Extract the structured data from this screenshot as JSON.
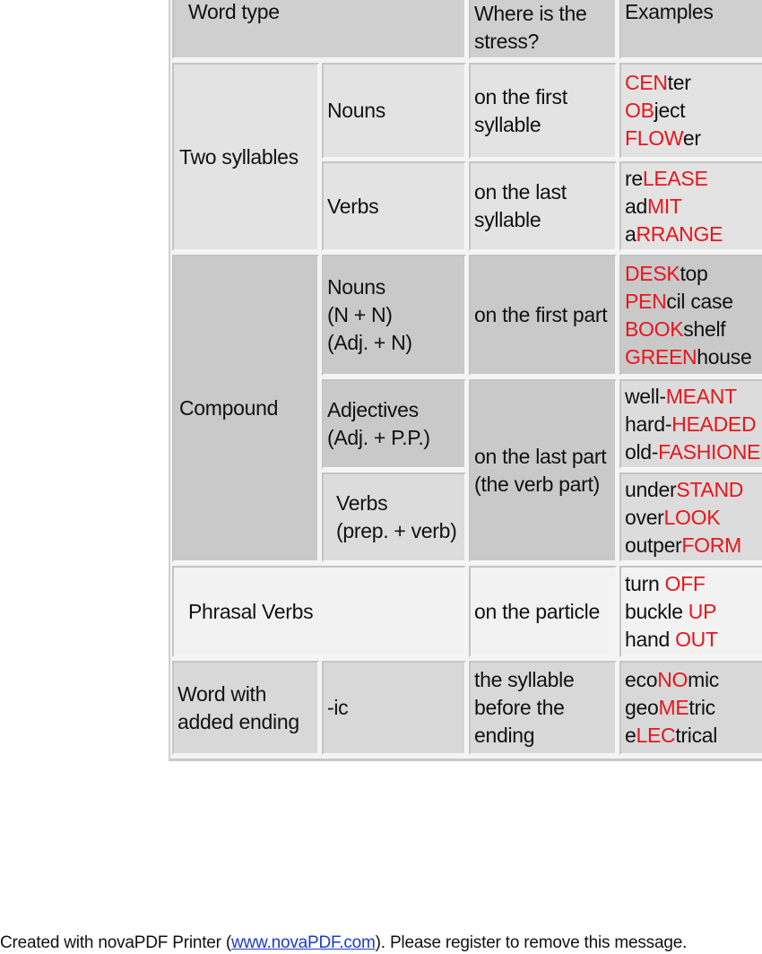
{
  "header": {
    "word_type": "Word type",
    "stress_line1": "Where is the",
    "stress_line2": "stress?",
    "examples": "Examples"
  },
  "rows": {
    "two_syllables": {
      "label": "Two syllables",
      "nouns": {
        "label": "Nouns",
        "stress": [
          "on the first",
          "syllable"
        ],
        "examples": [
          [
            {
              "t": "CEN",
              "r": true
            },
            {
              "t": "ter"
            }
          ],
          [
            {
              "t": "OB",
              "r": true
            },
            {
              "t": "ject"
            }
          ],
          [
            {
              "t": "FLOW",
              "r": true
            },
            {
              "t": "er"
            }
          ]
        ]
      },
      "verbs": {
        "label": "Verbs",
        "stress": [
          "on the last",
          "syllable"
        ],
        "examples": [
          [
            {
              "t": "re"
            },
            {
              "t": "LEASE",
              "r": true
            }
          ],
          [
            {
              "t": "ad"
            },
            {
              "t": "MIT",
              "r": true
            }
          ],
          [
            {
              "t": "a"
            },
            {
              "t": "RRANGE",
              "r": true
            }
          ]
        ]
      }
    },
    "compound": {
      "label": "Compound",
      "nouns": {
        "label": [
          "Nouns",
          "(N + N)",
          "(Adj. + N)"
        ],
        "stress": [
          "on the first part"
        ],
        "examples": [
          [
            {
              "t": "DESK",
              "r": true
            },
            {
              "t": "top"
            }
          ],
          [
            {
              "t": "PEN",
              "r": true
            },
            {
              "t": "cil case"
            }
          ],
          [
            {
              "t": "BOOK",
              "r": true
            },
            {
              "t": "shelf"
            }
          ],
          [
            {
              "t": "GREEN",
              "r": true
            },
            {
              "t": "house"
            }
          ]
        ]
      },
      "adjectives": {
        "label": [
          "Adjectives",
          "(Adj. + P.P.)"
        ],
        "examples": [
          [
            {
              "t": "well-"
            },
            {
              "t": "MEANT",
              "r": true
            }
          ],
          [
            {
              "t": "hard-"
            },
            {
              "t": "HEADED",
              "r": true
            }
          ],
          [
            {
              "t": "old-"
            },
            {
              "t": "FASHIONED",
              "r": true
            }
          ]
        ]
      },
      "verbs": {
        "label": [
          "Verbs",
          "(prep. + verb)"
        ],
        "examples": [
          [
            {
              "t": "under"
            },
            {
              "t": "STAND",
              "r": true
            }
          ],
          [
            {
              "t": "over"
            },
            {
              "t": "LOOK",
              "r": true
            }
          ],
          [
            {
              "t": "outper"
            },
            {
              "t": "FORM",
              "r": true
            }
          ]
        ]
      },
      "last_part_stress": [
        "on the last part",
        "(the verb part)"
      ]
    },
    "phrasal": {
      "label": "Phrasal Verbs",
      "stress": [
        "on the particle"
      ],
      "examples": [
        [
          {
            "t": "turn "
          },
          {
            "t": "OFF",
            "r": true
          }
        ],
        [
          {
            "t": "buckle "
          },
          {
            "t": "UP",
            "r": true
          }
        ],
        [
          {
            "t": "hand "
          },
          {
            "t": "OUT",
            "r": true
          }
        ]
      ]
    },
    "ending": {
      "label": [
        "Word with",
        "added ending"
      ],
      "suffix": "-ic",
      "stress": [
        "the syllable",
        "before the",
        "ending"
      ],
      "examples": [
        [
          {
            "t": "eco"
          },
          {
            "t": "NO",
            "r": true
          },
          {
            "t": "mic"
          }
        ],
        [
          {
            "t": "geo"
          },
          {
            "t": "ME",
            "r": true
          },
          {
            "t": "tric"
          }
        ],
        [
          {
            "t": "e"
          },
          {
            "t": "LEC",
            "r": true
          },
          {
            "t": "trical"
          }
        ]
      ]
    }
  },
  "footer": {
    "before": "Created with novaPDF Printer (",
    "link": "www.novaPDF.com",
    "after": "). Please register to remove this message."
  },
  "colors": {
    "stress_highlight": "#e8161b",
    "link": "#1a3cc8"
  }
}
